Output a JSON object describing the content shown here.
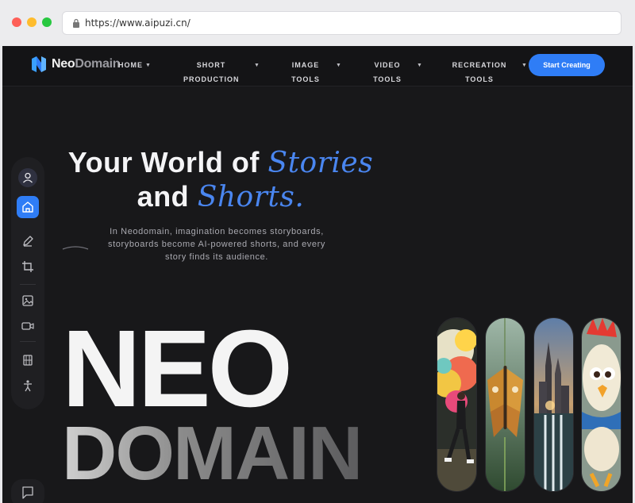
{
  "browser": {
    "url": "https://www.aipuzi.cn/"
  },
  "brand": {
    "name_light": "Neo",
    "name_dim": "Domain"
  },
  "nav": {
    "items": [
      {
        "line1": "HOME",
        "line2": ""
      },
      {
        "line1": "SHORT",
        "line2": "PRODUCTION"
      },
      {
        "line1": "IMAGE",
        "line2": "TOOLS"
      },
      {
        "line1": "VIDEO",
        "line2": "TOOLS"
      },
      {
        "line1": "RECREATION",
        "line2": "TOOLS"
      }
    ],
    "cta": "Start Creating"
  },
  "hero": {
    "line1_plain": "Your World of ",
    "line1_accent": "Stories",
    "line2_plain": "and ",
    "line2_accent": "Shorts.",
    "subtitle": "In Neodomain, imagination becomes storyboards, storyboards become AI-powered shorts, and every story finds its audience.",
    "big1": "NEO",
    "big2": "DOMAIN"
  },
  "sidebar": {
    "icons": [
      "user-icon",
      "home-icon",
      "pencil-icon",
      "crop-icon",
      "image-icon",
      "video-icon",
      "film-icon",
      "figure-icon"
    ],
    "chat_icon": "chat-icon"
  },
  "showcase": [
    "paint-splash-dancer",
    "butterfly",
    "castle-waterfall",
    "cartoon-chick"
  ],
  "colors": {
    "accent": "#2f7df6",
    "background": "#18181a"
  }
}
